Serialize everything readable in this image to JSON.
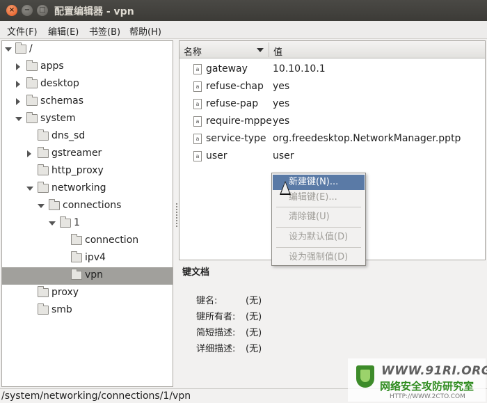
{
  "window": {
    "title": "配置编辑器 - vpn",
    "close_glyph": "×",
    "minimize_glyph": "−",
    "maximize_glyph": "□"
  },
  "menubar": {
    "items": [
      "文件(F)",
      "编辑(E)",
      "书签(B)",
      "帮助(H)"
    ]
  },
  "tree": {
    "nodes": [
      {
        "label": "/",
        "expanded": true
      },
      {
        "label": "apps",
        "expanded": false
      },
      {
        "label": "desktop",
        "expanded": false
      },
      {
        "label": "schemas",
        "expanded": false
      },
      {
        "label": "system",
        "expanded": true
      },
      {
        "label": "dns_sd"
      },
      {
        "label": "gstreamer",
        "expanded": false
      },
      {
        "label": "http_proxy"
      },
      {
        "label": "networking",
        "expanded": true
      },
      {
        "label": "connections",
        "expanded": true
      },
      {
        "label": "1",
        "expanded": true
      },
      {
        "label": "connection"
      },
      {
        "label": "ipv4"
      },
      {
        "label": "vpn",
        "selected": true
      },
      {
        "label": "proxy"
      },
      {
        "label": "smb"
      }
    ]
  },
  "table": {
    "col_name": "名称",
    "col_value": "值",
    "rows": [
      {
        "name": "gateway",
        "value": "10.10.10.1"
      },
      {
        "name": "refuse-chap",
        "value": "yes"
      },
      {
        "name": "refuse-pap",
        "value": "yes"
      },
      {
        "name": "require-mppe",
        "value": "yes"
      },
      {
        "name": "service-type",
        "value": "org.freedesktop.NetworkManager.pptp"
      },
      {
        "name": "user",
        "value": "user"
      }
    ]
  },
  "context_menu": {
    "items": [
      {
        "label": "新建键(N)...",
        "enabled": true,
        "active": true
      },
      {
        "label": "编辑键(E)...",
        "enabled": false
      },
      {
        "label": "清除键(U)",
        "enabled": false
      },
      {
        "label": "设为默认值(D)",
        "enabled": false
      },
      {
        "label": "设为强制值(D)",
        "enabled": false
      }
    ]
  },
  "key_doc": {
    "title": "键文档",
    "fields": [
      {
        "label": "键名:",
        "value": "(无)"
      },
      {
        "label": "键所有者:",
        "value": "(无)"
      },
      {
        "label": "简短描述:",
        "value": "(无)"
      },
      {
        "label": "详细描述:",
        "value": "(无)"
      }
    ]
  },
  "status": {
    "path": "/system/networking/connections/1/vpn"
  },
  "watermark": {
    "url": "WWW.91RI.ORG",
    "cn": "网络安全攻防研究室",
    "sub": "HTTP://WWW.2CTO.COM"
  },
  "colors": {
    "selection": "#a1a09c",
    "menu_highlight": "#5a7aa6",
    "titlebar": "#3c3b37"
  }
}
